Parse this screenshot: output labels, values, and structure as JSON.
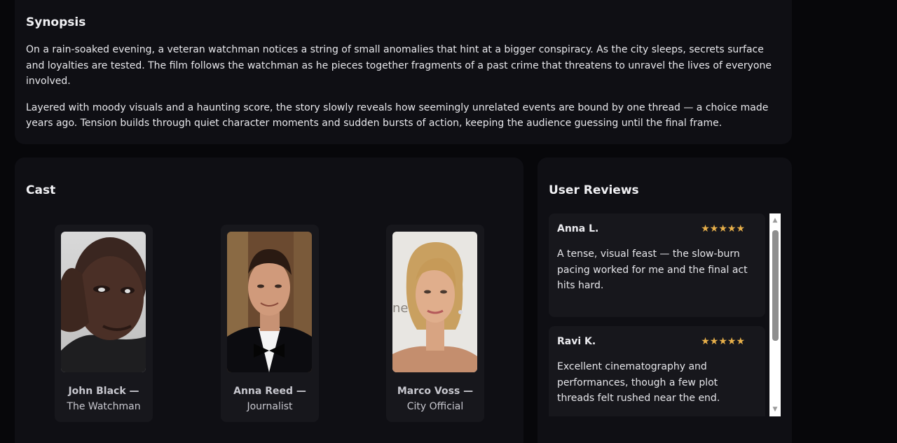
{
  "synopsis": {
    "title": "Synopsis",
    "paragraphs": [
      "On a rain-soaked evening, a veteran watchman notices a string of small anomalies that hint at a bigger conspiracy. As the city sleeps, secrets surface and loyalties are tested. The film follows the watchman as he pieces together fragments of a past crime that threatens to unravel the lives of everyone involved.",
      "Layered with moody visuals and a haunting score, the story slowly reveals how seemingly unrelated events are bound by one thread — a choice made years ago. Tension builds through quiet character moments and sudden bursts of action, keeping the audience guessing until the final frame."
    ]
  },
  "cast": {
    "title": "Cast",
    "members": [
      {
        "name": "John Black —",
        "role": "The Watchman"
      },
      {
        "name": "Anna Reed —",
        "role": "Journalist"
      },
      {
        "name": "Marco Voss —",
        "role": "City Official"
      }
    ]
  },
  "reviews": {
    "title": "User Reviews",
    "items": [
      {
        "author": "Anna L.",
        "stars": "★★★★★",
        "rating": 5,
        "text": "A tense, visual feast — the slow-burn pacing worked for me and the final act hits hard."
      },
      {
        "author": "Ravi K.",
        "stars": "★★★★★",
        "rating": 5,
        "text": "Excellent cinematography and performances, though a few plot threads felt rushed near the end."
      }
    ]
  },
  "colors": {
    "background": "#07070a",
    "card": "#0f0f14",
    "inner_card": "#17171c",
    "star": "#e8b04a"
  }
}
